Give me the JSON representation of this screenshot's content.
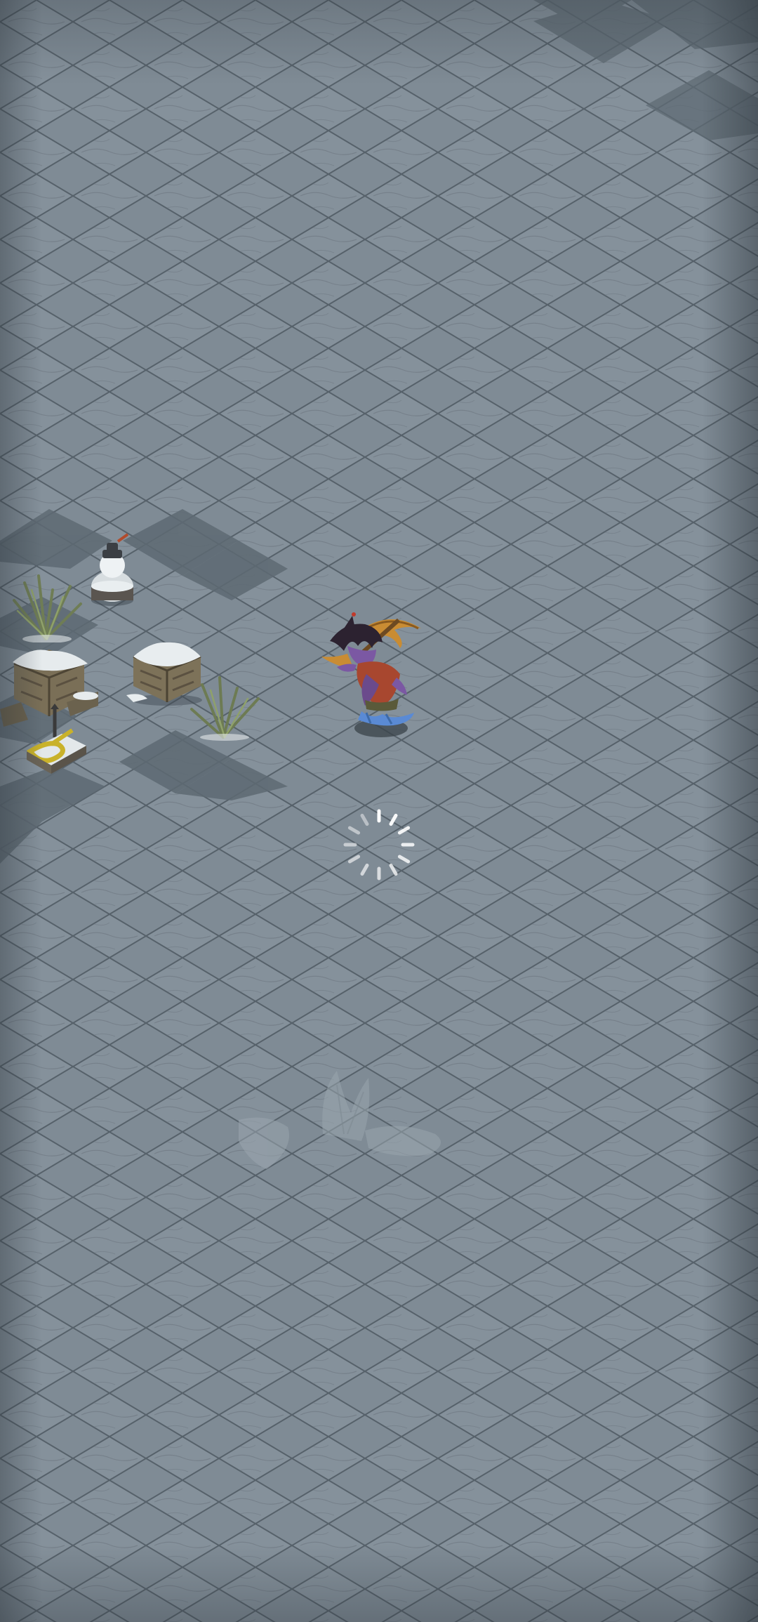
{
  "scene": {
    "kind": "isometric snow field",
    "state": "loading"
  },
  "colors": {
    "tile_light": "#8995a0",
    "tile_mid": "#7c8892",
    "tile_dark": "#66727c",
    "tile_line": "#4d5860",
    "snow": "#e8ecee",
    "spinner": "#ffffff",
    "character_skin": "#6b4a8c",
    "character_cloak": "#a8452e",
    "character_weapon": "#c9892f"
  },
  "icons": {
    "player": "hero-character-icon",
    "loading": "loading-spinner-icon",
    "props": [
      "snowman-icon",
      "grass-tuft-icon",
      "crate-icon",
      "broken-crate-icon",
      "lever-icon",
      "ghost-bush-icon"
    ]
  }
}
